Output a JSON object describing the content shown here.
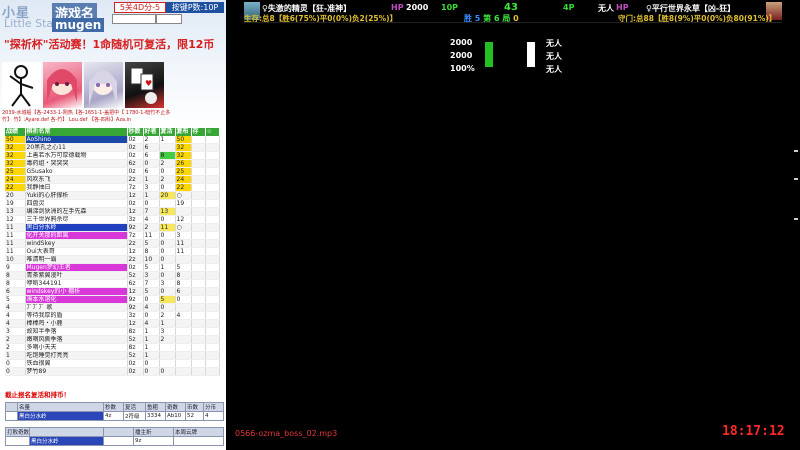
{
  "banner": {
    "logo": "小星",
    "logo_sub": "Little Star",
    "game_name": "游戏名",
    "engine": "mugen",
    "win_select": "5关4D分-5",
    "points": "按键P数:10P",
    "announcement": "\"探祈杯\"活动赛！1命随机可复活，限12币",
    "credits": [
      "2039-水城船【各-2433-1-刚热【各-1651-1-盖把中【 1780-1-暗竹不止多",
      "竹】   竹】:Ayare.def 各-竹】 Lou.def  【各-四科】Aza.in"
    ]
  },
  "table": {
    "headers": [
      "战绩",
      "棋祈名常",
      "秒数",
      "好者",
      "复活",
      "复布",
      "存",
      "☆"
    ],
    "rows": [
      {
        "c": [
          "50",
          "AoShino",
          "0z",
          "2",
          "1",
          "50",
          "",
          ""
        ],
        "hl": "yellow",
        "name_hl": "sel"
      },
      {
        "c": [
          "32",
          "20黑孔之心11",
          "0z",
          "6",
          "",
          "32",
          "",
          ""
        ],
        "hl": "yellow"
      },
      {
        "c": [
          "32",
          "上善若水万可厚德载物",
          "0z",
          "6",
          "8",
          "32",
          "",
          ""
        ],
        "hl": "yellow"
      },
      {
        "c": [
          "32",
          "毒药组・突突突",
          "6z",
          "0",
          "2",
          "26",
          "",
          ""
        ],
        "hl": "yellow"
      },
      {
        "c": [
          "25",
          "GSusako",
          "0z",
          "6",
          "0",
          "25",
          "",
          ""
        ],
        "hl": "yellow"
      },
      {
        "c": [
          "24",
          "风吹东飞",
          "2z",
          "1",
          "2",
          "24",
          "",
          ""
        ],
        "hl": "yellow"
      },
      {
        "c": [
          "22",
          "我静抽日",
          "7z",
          "3",
          "0",
          "22",
          "",
          ""
        ],
        "hl": "yellow"
      },
      {
        "c": [
          "20",
          "Yuki的心肝撑析",
          "1z",
          "1",
          "20",
          "○",
          "",
          ""
        ],
        "hl": ""
      },
      {
        "c": [
          "19",
          "四盘灵",
          "0z",
          "0",
          "",
          "19",
          "",
          ""
        ],
        "hl": ""
      },
      {
        "c": [
          "13",
          "编涕剑狄洲的左手先森",
          "1z",
          "7",
          "13",
          "",
          "",
          ""
        ],
        "hl": ""
      },
      {
        "c": [
          "12",
          "三千世界鸦杀尽",
          "3z",
          "4",
          "0",
          "12",
          "",
          ""
        ],
        "hl": ""
      },
      {
        "c": [
          "11",
          "黑白分水岭",
          "9z",
          "2",
          "11",
          "○",
          "",
          ""
        ],
        "hl": "",
        "name_hl": "blue"
      },
      {
        "c": [
          "11",
          "化开关那的距离",
          "7z",
          "11",
          "0",
          "3",
          "",
          ""
        ],
        "hl": "",
        "name_hl": "magenta"
      },
      {
        "c": [
          "11",
          "windSkey",
          "2z",
          "5",
          "0",
          "11",
          "",
          ""
        ],
        "hl": ""
      },
      {
        "c": [
          "11",
          "Oui大表哥",
          "1z",
          "8",
          "0",
          "11",
          "",
          ""
        ],
        "hl": ""
      },
      {
        "c": [
          "10",
          "唯清明一霸",
          "2z",
          "10",
          "0",
          "",
          "",
          ""
        ],
        "hl": ""
      },
      {
        "c": [
          "9",
          "Mugen梦幻王者",
          "0z",
          "5",
          "1",
          "5",
          "",
          ""
        ],
        "hl": "",
        "name_hl": "magenta"
      },
      {
        "c": [
          "8",
          "青茶紫翼漫叶",
          "5z",
          "3",
          "0",
          "8",
          "",
          ""
        ],
        "hl": ""
      },
      {
        "c": [
          "8",
          "咿喲344191",
          "6z",
          "7",
          "3",
          "8",
          "",
          ""
        ],
        "hl": ""
      },
      {
        "c": [
          "6",
          "windskey的小 棚析",
          "1z",
          "5",
          "0",
          "6",
          "",
          ""
        ],
        "hl": "",
        "name_hl": "magenta"
      },
      {
        "c": [
          "5",
          "凑本水溶化",
          "9z",
          "0",
          "5",
          "0",
          "",
          ""
        ],
        "hl": "",
        "name_hl": "magenta"
      },
      {
        "c": [
          "4",
          "ﾌﾞﾌﾞﾌﾞ 歌",
          "9z",
          "4",
          "0",
          "",
          "",
          ""
        ],
        "hl": ""
      },
      {
        "c": [
          "4",
          "等待我厚的盾",
          "3z",
          "0",
          "2",
          "4",
          "",
          ""
        ],
        "hl": ""
      },
      {
        "c": [
          "4",
          "棒棒鸡・小鹿",
          "1z",
          "4",
          "1",
          "",
          "",
          ""
        ],
        "hl": ""
      },
      {
        "c": [
          "3",
          "故知半季落",
          "8z",
          "1",
          "3",
          "",
          "",
          ""
        ],
        "hl": ""
      },
      {
        "c": [
          "2",
          "嫩嘀风撕季落",
          "5z",
          "1",
          "2",
          "",
          "",
          ""
        ],
        "hl": ""
      },
      {
        "c": [
          "2",
          "多嘀小天天",
          "8z",
          "1",
          "",
          "",
          "",
          ""
        ],
        "hl": ""
      },
      {
        "c": [
          "1",
          "吃饱睡觉打亮亮",
          "5z",
          "1",
          "",
          "",
          "",
          ""
        ],
        "hl": ""
      },
      {
        "c": [
          "0",
          "铁血很翼",
          "0z",
          "0",
          "",
          "",
          "",
          ""
        ],
        "hl": ""
      },
      {
        "c": [
          "0",
          "梦竹89",
          "0z",
          "0",
          "0",
          "",
          "",
          ""
        ],
        "hl": ""
      }
    ],
    "footer": "截止报名复活和排币！"
  },
  "info1": {
    "headers": [
      "",
      "名量",
      "秒数",
      "复活",
      "鱼粗",
      "奇数",
      "币数",
      "分币"
    ],
    "row": [
      "",
      "黑白分水岭",
      "4z",
      "2符级",
      "3334",
      "Ab10",
      "52",
      "4"
    ]
  },
  "info2": {
    "headers": [
      "打败奇数",
      "",
      "",
      "播主折",
      "本周云牌"
    ],
    "row": [
      "",
      "黑白分水岭",
      "",
      "9z",
      ""
    ]
  },
  "hud": {
    "p1_name": "♀失激的精灵【狂-准神】",
    "p1_hp_label": "HP",
    "p1_hp": "2000",
    "p1_points": "10P",
    "round_center": "43",
    "p2_points": "4P",
    "p2_name": "无人",
    "p2_hp_label": "HP",
    "p2_title": "♀平行世界永草【凶-狂】",
    "p1_stat": "生存:总8【胜6(75%)平0(0%)负2(25%)】",
    "p2_stat": "守门:总88【胜8(9%)平0(0%)负80(91%)】",
    "score": {
      "a": "胜",
      "b": "5",
      "c": "第",
      "d": "6",
      "e": "局",
      "f": "0"
    }
  },
  "center": {
    "left_vals": [
      "2000",
      "2000",
      "100%"
    ],
    "right_vals": [
      "无人",
      "无人",
      "无人"
    ]
  },
  "music": "0566-ozma_boss_02.mp3",
  "clock": "18:17:12",
  "colors": {
    "accent_green": "#37a637",
    "highlight_yellow": "#ffd700",
    "hud_red": "#ff2828"
  }
}
